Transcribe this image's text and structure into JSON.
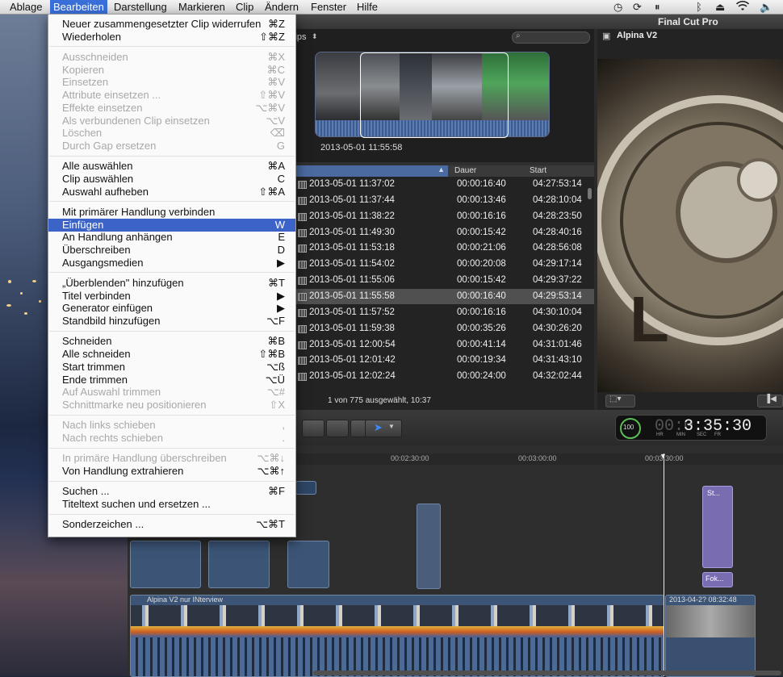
{
  "menubar": {
    "items": [
      "Ablage",
      "Bearbeiten",
      "Darstellung",
      "Markieren",
      "Clip",
      "Ändern",
      "Fenster",
      "Hilfe"
    ],
    "active": "Bearbeiten",
    "status_icons": [
      "clock-icon",
      "sync-icon",
      "pause-icon",
      "bluetooth-icon",
      "eject-icon",
      "wifi-icon",
      "volume-icon"
    ]
  },
  "window": {
    "title": "Final Cut Pro"
  },
  "browser": {
    "filter_label": "lips",
    "filmstrip_time": "2013-05-01 11:55:58",
    "columns": [
      "Dauer",
      "Start"
    ],
    "rows": [
      {
        "name": "2013-05-01 11:37:02",
        "dauer": "00:00:16:40",
        "start": "04:27:53:14"
      },
      {
        "name": "2013-05-01 11:37:44",
        "dauer": "00:00:13:46",
        "start": "04:28:10:04"
      },
      {
        "name": "2013-05-01 11:38:22",
        "dauer": "00:00:16:16",
        "start": "04:28:23:50"
      },
      {
        "name": "2013-05-01 11:49:30",
        "dauer": "00:00:15:42",
        "start": "04:28:40:16"
      },
      {
        "name": "2013-05-01 11:53:18",
        "dauer": "00:00:21:06",
        "start": "04:28:56:08"
      },
      {
        "name": "2013-05-01 11:54:02",
        "dauer": "00:00:20:08",
        "start": "04:29:17:14"
      },
      {
        "name": "2013-05-01 11:55:06",
        "dauer": "00:00:15:42",
        "start": "04:29:37:22"
      },
      {
        "name": "2013-05-01 11:55:58",
        "dauer": "00:00:16:40",
        "start": "04:29:53:14",
        "selected": true
      },
      {
        "name": "2013-05-01 11:57:52",
        "dauer": "00:00:16:16",
        "start": "04:30:10:04"
      },
      {
        "name": "2013-05-01 11:59:38",
        "dauer": "00:00:35:26",
        "start": "04:30:26:20"
      },
      {
        "name": "2013-05-01 12:00:54",
        "dauer": "00:00:41:14",
        "start": "04:31:01:46"
      },
      {
        "name": "2013-05-01 12:01:42",
        "dauer": "00:00:19:34",
        "start": "04:31:43:10"
      },
      {
        "name": "2013-05-01 12:02:24",
        "dauer": "00:00:24:00",
        "start": "04:32:02:44"
      }
    ],
    "footer": "1 von 775 ausgewählt, 10:37"
  },
  "viewer": {
    "title": "Alpina V2"
  },
  "timecode": {
    "level": "100",
    "value": "3:35:30",
    "dim_prefix": "00:0",
    "units": [
      "HR",
      "MIN",
      "SEC",
      "FR"
    ]
  },
  "timeline": {
    "ruler": [
      "00:02:30:00",
      "00:03:00:00",
      "00:03:30:00"
    ],
    "primary_clip": "Alpina V2 nur INterview",
    "second_clip": "2013-04-2? 08:32:48",
    "connected": [
      "St...",
      "Fok..."
    ]
  },
  "menu": {
    "items": [
      {
        "label": "Neuer zusammengesetzter Clip widerrufen",
        "shortcut": "⌘Z",
        "enabled": true
      },
      {
        "label": "Wiederholen",
        "shortcut": "⇧⌘Z",
        "enabled": true
      },
      {
        "sep": true
      },
      {
        "label": "Ausschneiden",
        "shortcut": "⌘X",
        "enabled": false
      },
      {
        "label": "Kopieren",
        "shortcut": "⌘C",
        "enabled": false
      },
      {
        "label": "Einsetzen",
        "shortcut": "⌘V",
        "enabled": false
      },
      {
        "label": "Attribute einsetzen ...",
        "shortcut": "⇧⌘V",
        "enabled": false
      },
      {
        "label": "Effekte einsetzen",
        "shortcut": "⌥⌘V",
        "enabled": false
      },
      {
        "label": "Als verbundenen Clip einsetzen",
        "shortcut": "⌥V",
        "enabled": false
      },
      {
        "label": "Löschen",
        "shortcut": "⌫",
        "enabled": false
      },
      {
        "label": "Durch Gap ersetzen",
        "shortcut": "G",
        "enabled": false
      },
      {
        "sep": true
      },
      {
        "label": "Alle auswählen",
        "shortcut": "⌘A",
        "enabled": true
      },
      {
        "label": "Clip auswählen",
        "shortcut": "C",
        "enabled": true
      },
      {
        "label": "Auswahl aufheben",
        "shortcut": "⇧⌘A",
        "enabled": true
      },
      {
        "sep": true
      },
      {
        "label": "Mit primärer Handlung verbinden",
        "shortcut": "",
        "enabled": true
      },
      {
        "label": "Einfügen",
        "shortcut": "W",
        "enabled": true,
        "highlighted": true
      },
      {
        "label": "An Handlung anhängen",
        "shortcut": "E",
        "enabled": true
      },
      {
        "label": "Überschreiben",
        "shortcut": "D",
        "enabled": true
      },
      {
        "label": "Ausgangsmedien",
        "shortcut": "▶",
        "enabled": true
      },
      {
        "sep": true
      },
      {
        "label": "„Überblenden\" hinzufügen",
        "shortcut": "⌘T",
        "enabled": true
      },
      {
        "label": "Titel verbinden",
        "shortcut": "▶",
        "enabled": true
      },
      {
        "label": "Generator einfügen",
        "shortcut": "▶",
        "enabled": true
      },
      {
        "label": "Standbild hinzufügen",
        "shortcut": "⌥F",
        "enabled": true
      },
      {
        "sep": true
      },
      {
        "label": "Schneiden",
        "shortcut": "⌘B",
        "enabled": true
      },
      {
        "label": "Alle schneiden",
        "shortcut": "⇧⌘B",
        "enabled": true
      },
      {
        "label": "Start trimmen",
        "shortcut": "⌥ß",
        "enabled": true
      },
      {
        "label": "Ende trimmen",
        "shortcut": "⌥Ü",
        "enabled": true
      },
      {
        "label": "Auf Auswahl trimmen",
        "shortcut": "⌥#",
        "enabled": false
      },
      {
        "label": "Schnittmarke neu positionieren",
        "shortcut": "⇧X",
        "enabled": false
      },
      {
        "sep": true
      },
      {
        "label": "Nach links schieben",
        "shortcut": ",",
        "enabled": false
      },
      {
        "label": "Nach rechts schieben",
        "shortcut": ".",
        "enabled": false
      },
      {
        "sep": true
      },
      {
        "label": "In primäre Handlung überschreiben",
        "shortcut": "⌥⌘↓",
        "enabled": false
      },
      {
        "label": "Von Handlung extrahieren",
        "shortcut": "⌥⌘↑",
        "enabled": true
      },
      {
        "sep": true
      },
      {
        "label": "Suchen ...",
        "shortcut": "⌘F",
        "enabled": true
      },
      {
        "label": "Titeltext suchen und ersetzen ...",
        "shortcut": "",
        "enabled": true
      },
      {
        "sep": true
      },
      {
        "label": "Sonderzeichen ...",
        "shortcut": "⌥⌘T",
        "enabled": true
      }
    ]
  }
}
